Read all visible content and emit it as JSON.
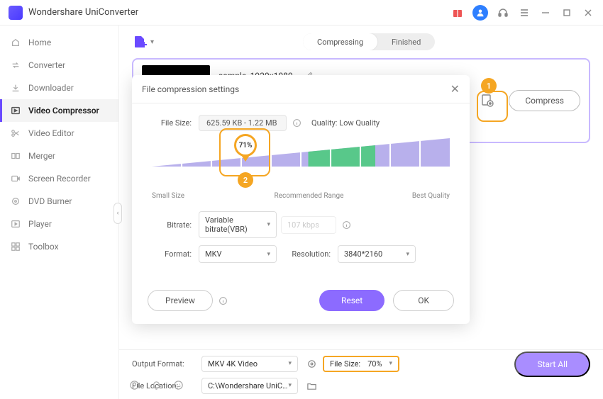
{
  "app": {
    "title": "Wondershare UniConverter"
  },
  "sidebar": {
    "items": [
      {
        "icon": "home",
        "label": "Home"
      },
      {
        "icon": "converter",
        "label": "Converter"
      },
      {
        "icon": "downloader",
        "label": "Downloader"
      },
      {
        "icon": "compressor",
        "label": "Video Compressor"
      },
      {
        "icon": "editor",
        "label": "Video Editor"
      },
      {
        "icon": "merger",
        "label": "Merger"
      },
      {
        "icon": "recorder",
        "label": "Screen Recorder"
      },
      {
        "icon": "dvd",
        "label": "DVD Burner"
      },
      {
        "icon": "player",
        "label": "Player"
      },
      {
        "icon": "toolbox",
        "label": "Toolbox"
      }
    ]
  },
  "tabs": {
    "compressing": "Compressing",
    "finished": "Finished"
  },
  "file": {
    "name": "sample_1920x1080",
    "compress_button": "Compress"
  },
  "callouts": {
    "one": "1",
    "two": "2"
  },
  "modal": {
    "title": "File compression settings",
    "labels": {
      "filesize": "File Size:",
      "quality": "Quality: Low Quality",
      "bitrate": "Bitrate:",
      "format": "Format:",
      "resolution": "Resolution:"
    },
    "filesize_value": "625.59 KB - 1.22 MB",
    "percent": "71%",
    "slider_labels": {
      "small": "Small Size",
      "rec": "Recommended Range",
      "best": "Best Quality"
    },
    "bitrate_value": "Variable bitrate(VBR)",
    "kbps_placeholder": "107 kbps",
    "format_value": "MKV",
    "resolution_value": "3840*2160",
    "buttons": {
      "preview": "Preview",
      "reset": "Reset",
      "ok": "OK"
    }
  },
  "bottom": {
    "output_format_label": "Output Format:",
    "output_format_value": "MKV 4K Video",
    "file_location_label": "File Location:",
    "file_location_value": "C:\\Wondershare UniConverter",
    "filesize_label": "File Size:",
    "filesize_value": "70%",
    "start_all": "Start All"
  }
}
